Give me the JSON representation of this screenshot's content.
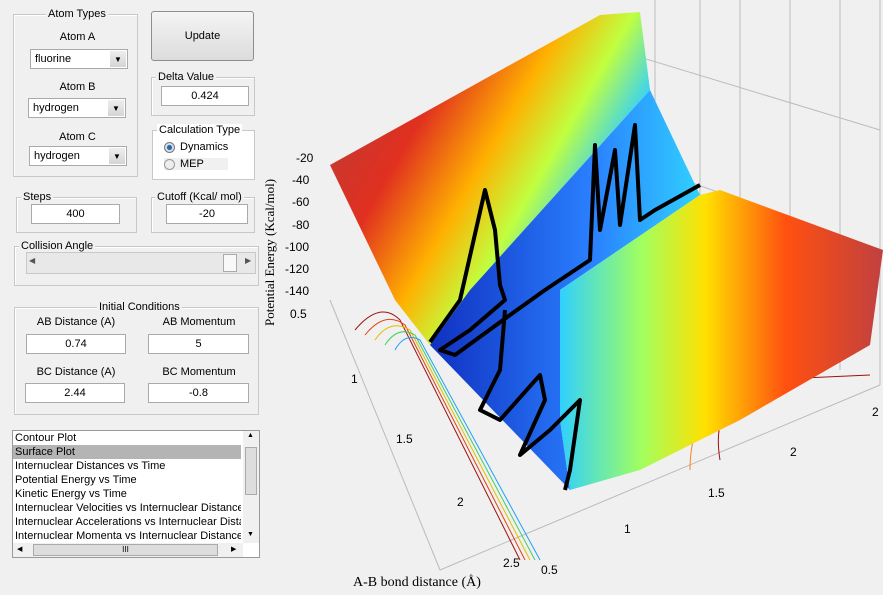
{
  "atom_types": {
    "title": "Atom Types",
    "atom_a_label": "Atom A",
    "atom_a": "fluorine",
    "atom_b_label": "Atom B",
    "atom_b": "hydrogen",
    "atom_c_label": "Atom C",
    "atom_c": "hydrogen"
  },
  "update_label": "Update",
  "delta": {
    "title": "Delta Value",
    "value": "0.424"
  },
  "calc": {
    "title": "Calculation Type",
    "opt1": "Dynamics",
    "opt2": "MEP",
    "selected": "Dynamics"
  },
  "steps": {
    "title": "Steps",
    "value": "400"
  },
  "cutoff": {
    "title": "Cutoff (Kcal/ mol)",
    "value": "-20"
  },
  "collision": {
    "title": "Collision Angle",
    "value_fraction": 1.0
  },
  "initial": {
    "title": "Initial Conditions",
    "ab_dist_label": "AB Distance (A)",
    "ab_dist": "0.74",
    "ab_mom_label": "AB Momentum",
    "ab_mom": "5",
    "bc_dist_label": "BC Distance (A)",
    "bc_dist": "2.44",
    "bc_mom_label": "BC Momentum",
    "bc_mom": "-0.8"
  },
  "plot_list": {
    "items": [
      "Contour Plot",
      "Surface Plot",
      "Internuclear Distances vs Time",
      "Potential Energy vs Time",
      "Kinetic Energy vs Time",
      "Internuclear Velocities vs Internuclear Distance",
      "Internuclear Accelerations vs Internuclear Distance",
      "Internuclear Momenta vs Internuclear Distance"
    ],
    "selected": "Surface Plot",
    "scroll_grip": "III"
  },
  "plot": {
    "zlabel": "Potential Energy (Kcal/mol)",
    "xlabel": "A-B bond distance (Å)",
    "zticks": [
      "-20",
      "-40",
      "-60",
      "-80",
      "-100",
      "-120",
      "-140"
    ],
    "xticks": [
      "0.5",
      "1",
      "1.5",
      "2",
      "2.5"
    ],
    "yticks": [
      "0.5",
      "1",
      "1.5",
      "2"
    ]
  }
}
